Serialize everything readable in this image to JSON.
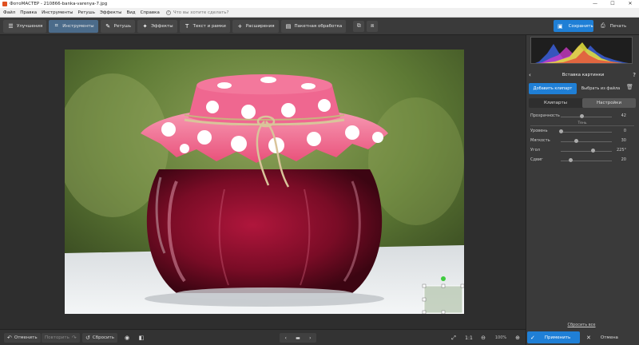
{
  "titlebar": {
    "title": "ФотоМАСТЕР - 210866-banka-varenya-7.jpg",
    "minimize": "—",
    "maximize": "☐",
    "close": "✕"
  },
  "menu": {
    "items": [
      "Файл",
      "Правка",
      "Инструменты",
      "Ретушь",
      "Эффекты",
      "Вид",
      "Справка"
    ],
    "help_search": "Что вы хотите сделать?"
  },
  "toolbar": {
    "tabs": [
      {
        "label": "Улучшения",
        "icon": "sliders-icon",
        "glyph": "☰"
      },
      {
        "label": "Инструменты",
        "icon": "crop-icon",
        "glyph": "⌗"
      },
      {
        "label": "Ретушь",
        "icon": "brush-icon",
        "glyph": "✎"
      },
      {
        "label": "Эффекты",
        "icon": "magic-wand-icon",
        "glyph": "✦"
      },
      {
        "label": "Текст и рамки",
        "icon": "text-icon",
        "glyph": "T"
      },
      {
        "label": "Расширения",
        "icon": "plus-icon",
        "glyph": "+"
      },
      {
        "label": "Пакетная обработка",
        "icon": "batch-icon",
        "glyph": "▤"
      }
    ],
    "save_label": "Сохранить",
    "print_label": "Печать"
  },
  "panel": {
    "title": "Вставка картинки",
    "add_clipart": "Добавить клипарт",
    "choose_file": "Выбрать из файла",
    "tab_cliparts": "Клипарты",
    "tab_settings": "Настройки",
    "opacity": {
      "label": "Прозрачность",
      "value": "42",
      "level": 0.42
    },
    "shadow_label": "Тень",
    "level": {
      "label": "Уровень",
      "value": "0",
      "level": 0.0
    },
    "softness": {
      "label": "Мягкость",
      "value": "30",
      "level": 0.3
    },
    "angle": {
      "label": "Угол",
      "value": "225°",
      "level": 0.625
    },
    "offset": {
      "label": "Сдвиг",
      "value": "20",
      "level": 0.2
    },
    "reset_all": "Сбросить все",
    "apply": "Применить",
    "cancel": "Отмена"
  },
  "bottom": {
    "undo": "Отменить",
    "redo": "Повторить",
    "reset": "Сбросить",
    "one_to_one": "1:1",
    "zoom": "100%"
  },
  "colors": {
    "accent": "#1f7fd6",
    "toolbar_bg": "#3a3a3a",
    "canvas_bg": "#2e2e2e",
    "lid_pink": "#f0608a",
    "jam": "#8a0f2c"
  }
}
